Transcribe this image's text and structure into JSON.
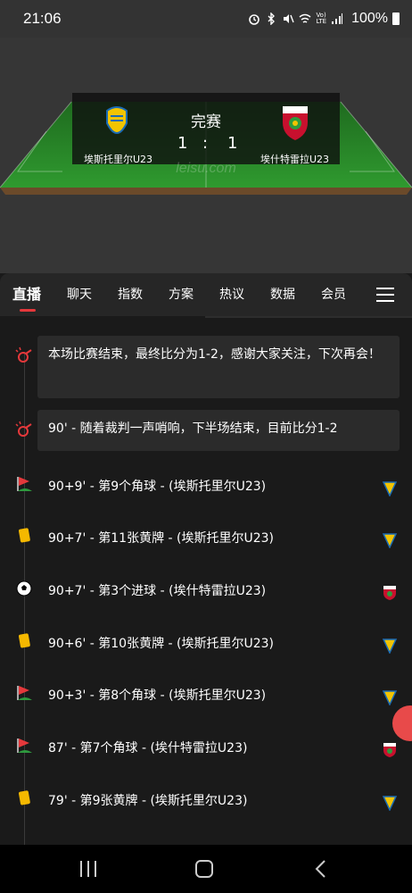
{
  "status_bar": {
    "time": "21:06",
    "battery": "100%",
    "network": "Vo)\nLTE"
  },
  "match": {
    "status": "完赛",
    "home_team": "埃斯托里尔U23",
    "away_team": "埃什特雷拉U23",
    "home_score": "1",
    "separator": ":",
    "away_score": "1",
    "watermark": "leisu.com"
  },
  "tabs": [
    {
      "label": "直播",
      "active": true
    },
    {
      "label": "聊天"
    },
    {
      "label": "指数"
    },
    {
      "label": "方案"
    },
    {
      "label": "热议"
    },
    {
      "label": "数据"
    },
    {
      "label": "会员"
    }
  ],
  "events": [
    {
      "icon": "whistle-icon",
      "text": "本场比赛结束，最终比分为1-2，感谢大家关注，下次再会！",
      "boxed": true
    },
    {
      "icon": "whistle-icon",
      "text": "90' - 随着裁判一声哨响，下半场结束，目前比分1-2",
      "boxed": true
    },
    {
      "icon": "corner-flag-icon",
      "text": "90+9' - 第9个角球 - (埃斯托里尔U23)",
      "team": "home"
    },
    {
      "icon": "yellow-card-icon",
      "text": "90+7' - 第11张黄牌 - (埃斯托里尔U23)",
      "team": "home"
    },
    {
      "icon": "goal-ball-icon",
      "text": "90+7' - 第3个进球 - (埃什特雷拉U23)",
      "team": "away"
    },
    {
      "icon": "yellow-card-icon",
      "text": "90+6' - 第10张黄牌 - (埃斯托里尔U23)",
      "team": "home"
    },
    {
      "icon": "corner-flag-icon",
      "text": "90+3' - 第8个角球 - (埃斯托里尔U23)",
      "team": "home"
    },
    {
      "icon": "corner-flag-icon",
      "text": "87' - 第7个角球 - (埃什特雷拉U23)",
      "team": "away"
    },
    {
      "icon": "yellow-card-icon",
      "text": "79' - 第9张黄牌 - (埃斯托里尔U23)",
      "team": "home"
    }
  ],
  "colors": {
    "accent": "#e5383b",
    "pitch": "#2e8b2e",
    "yellow_card": "#f5b800"
  }
}
